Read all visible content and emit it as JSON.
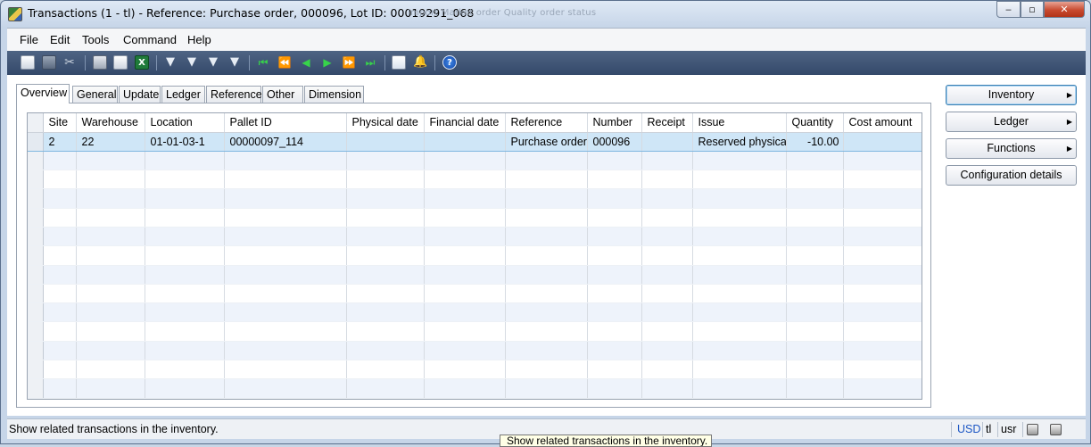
{
  "window": {
    "title": "Transactions (1 - tl) - Reference: Purchase order, 000096, Lot ID: 00019291_068",
    "ghost_title": "Import      Market order      Quality order status",
    "controls": {
      "minimize": "‒",
      "maximize": "▫",
      "close": "✕"
    }
  },
  "menu": [
    "File",
    "Edit",
    "Tools",
    "Command",
    "Help"
  ],
  "toolbar": {
    "icons": [
      "new-icon",
      "save-icon",
      "delete-icon",
      "print-icon",
      "print-preview-icon",
      "export-excel-icon",
      "filter-by-selection-icon",
      "filter-by-grid-icon",
      "advanced-filter-icon",
      "remove-filter-icon",
      "first-record-icon",
      "previous-page-icon",
      "previous-record-icon",
      "next-record-icon",
      "next-page-icon",
      "last-record-icon",
      "document-handling-icon",
      "alert-icon",
      "help-icon"
    ],
    "glyphs": {
      "xls": "X",
      "help": "?"
    }
  },
  "tabs": [
    "Overview",
    "General",
    "Update",
    "Ledger",
    "Reference",
    "Other",
    "Dimension"
  ],
  "active_tab": "Overview",
  "grid": {
    "columns": [
      "Site",
      "Warehouse",
      "Location",
      "Pallet ID",
      "Physical date",
      "Financial date",
      "Reference",
      "Number",
      "Receipt",
      "Issue",
      "Quantity",
      "Cost amount"
    ],
    "rows": [
      {
        "site": "2",
        "warehouse": "22",
        "location": "01-01-03-1",
        "pallet_id": "00000097_114",
        "physical_date": "",
        "financial_date": "",
        "reference": "Purchase order",
        "number": "000096",
        "receipt": "",
        "issue": "Reserved physical",
        "quantity": "-10.00",
        "cost_amount": ""
      }
    ],
    "empty_rows": 13,
    "highlight": {
      "column": "Issue",
      "color": "#d21a2a"
    },
    "selected_row_color": "#cfe6f7"
  },
  "side_buttons": [
    {
      "label": "Inventory",
      "has_menu": true
    },
    {
      "label": "Ledger",
      "has_menu": true
    },
    {
      "label": "Functions",
      "has_menu": true
    },
    {
      "label": "Configuration details",
      "has_menu": false
    }
  ],
  "menu_arrow": "▶",
  "status": {
    "text": "Show related transactions in the inventory.",
    "currency": "USD",
    "company": "tl",
    "user": "usr"
  },
  "tooltip": "Show related transactions in the inventory."
}
